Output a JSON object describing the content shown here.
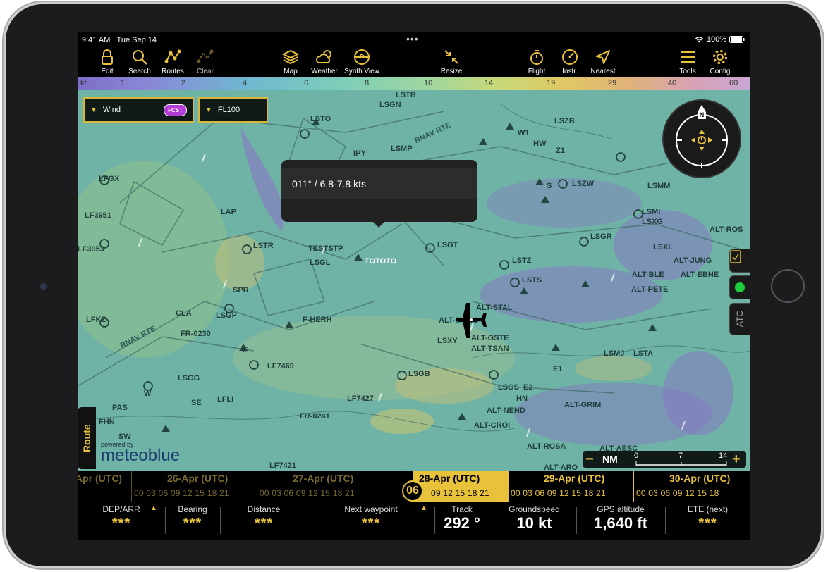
{
  "status": {
    "time": "9:41 AM",
    "date": "Tue Sep 14",
    "battery": "100%"
  },
  "toolbar": {
    "edit": "Edit",
    "search": "Search",
    "routes": "Routes",
    "clear": "Clear",
    "map": "Map",
    "weather": "Weather",
    "synth_view": "Synth View",
    "resize": "Resize",
    "flight": "Flight",
    "instr": "Instr.",
    "nearest": "Nearest",
    "tools": "Tools",
    "config": "Config"
  },
  "wind_scale": {
    "unit": "kt",
    "values": [
      "1",
      "2",
      "4",
      "6",
      "8",
      "10",
      "14",
      "19",
      "29",
      "40",
      "60"
    ]
  },
  "layer_selector": {
    "layer": "Wind",
    "badge": "FCST",
    "level": "FL100"
  },
  "tooltip": {
    "text": "011° / 6.8-7.8 kts"
  },
  "map_labels": {
    "lsgn": "LSGN",
    "lsto": "LSTO",
    "lstb": "LSTB",
    "lszb": "LSZB",
    "w1": "W1",
    "hw": "HW",
    "z1": "Z1",
    "lszw": "LSZW",
    "s": "S",
    "lsmm": "LSMM",
    "lsmp": "LSMP",
    "ipy": "IPY",
    "lfgx": "LFGX",
    "lf3951": "LF3951",
    "lf3953": "LF3953",
    "lap": "LAP",
    "lstr": "LSTR",
    "teststp": "TESTSTP",
    "lsgl": "LSGL",
    "tototo": "TOTOTO",
    "lsgt": "LSGT",
    "lstz": "LSTZ",
    "lsmi": "LSMI",
    "lsxg": "LSXG",
    "lsgr": "LSGR",
    "lsxl": "LSXL",
    "alt_ros": "ALT-ROS",
    "alt_jung": "ALT-JUNG",
    "alt_ble": "ALT-BLE",
    "alt_ebne": "ALT-EBNE",
    "alt_pete": "ALT-PETE",
    "lsts": "LSTS",
    "alt_stal": "ALT-STAL",
    "alt_moss": "ALT-MOSS",
    "spr": "SPR",
    "cla": "CLA",
    "lsgp": "LSGP",
    "f_herh": "F-HERH",
    "lfkz": "LFKZ",
    "fr0230": "FR-0230",
    "rnav1": "RNAV RTE",
    "rnav2": "RNAV RTE",
    "e": "E",
    "lsxy": "LSXY",
    "alt_gste": "ALT-GSTE",
    "alt_tsan": "ALT-TSAN",
    "lsmj": "LSMJ",
    "lsta": "LSTA",
    "e1": "E1",
    "lf7469": "LF7469",
    "lsgb": "LSGB",
    "lsgs": "LSGS",
    "e2": "E2",
    "lsgg": "LSGG",
    "w": "W",
    "se": "SE",
    "lfli": "LFLI",
    "lf7427": "LF7427",
    "hn": "HN",
    "alt_grim": "ALT-GRIM",
    "alt_nend": "ALT-NEND",
    "pas": "PAS",
    "fhn": "FHN",
    "fr0241": "FR-0241",
    "alt_croi": "ALT-CROI",
    "sw": "SW",
    "alt_rosa": "ALT-ROSA",
    "alt_aesc": "ALT-AESC",
    "lf7421": "LF7421",
    "alt_aro": "ALT-ARO"
  },
  "side_tabs": {
    "atc": "ATC"
  },
  "route_tab": "Route",
  "branding": {
    "powered_by": "powered by",
    "logo": "meteoblue"
  },
  "scale_bar": {
    "unit": "NM",
    "ticks": [
      "0",
      "7",
      "14"
    ]
  },
  "timeline": {
    "now_hour": "06",
    "days": [
      {
        "label": "Apr (UTC)",
        "hours": "00 03 06 09 12 15 18 21"
      },
      {
        "label": "26-Apr (UTC)",
        "hours": "00 03 06 09 12 15 18 21"
      },
      {
        "label": "27-Apr (UTC)",
        "hours": "00 03 06 09 12 15 18 21"
      },
      {
        "label": "28-Apr (UTC)",
        "hours": "09 12 15 18 21"
      },
      {
        "label": "29-Apr (UTC)",
        "hours": "00 03 06 09 12 15 18 21"
      },
      {
        "label": "30-Apr (UTC)",
        "hours": "00 03 06 09 12 15 18"
      }
    ]
  },
  "instruments": {
    "dep_arr": {
      "label": "DEP/ARR",
      "value": "***"
    },
    "bearing": {
      "label": "Bearing",
      "value": "***"
    },
    "distance": {
      "label": "Distance",
      "value": "***"
    },
    "next_waypoint": {
      "label": "Next waypoint",
      "value": "***"
    },
    "track": {
      "label": "Track",
      "value": "292 °"
    },
    "groundspeed": {
      "label": "Groundspeed",
      "value": "10 kt"
    },
    "gps_altitude": {
      "label": "GPS altitude",
      "value": "1,640 ft"
    },
    "ete_next": {
      "label": "ETE (next)",
      "value": "***"
    }
  },
  "colors": {
    "accent": "#e8c23a",
    "fcst_badge": "#b33bd6",
    "status_green": "#1ccf3a",
    "map_base": "#6fb3a6",
    "precip": "#8a6fc7"
  }
}
